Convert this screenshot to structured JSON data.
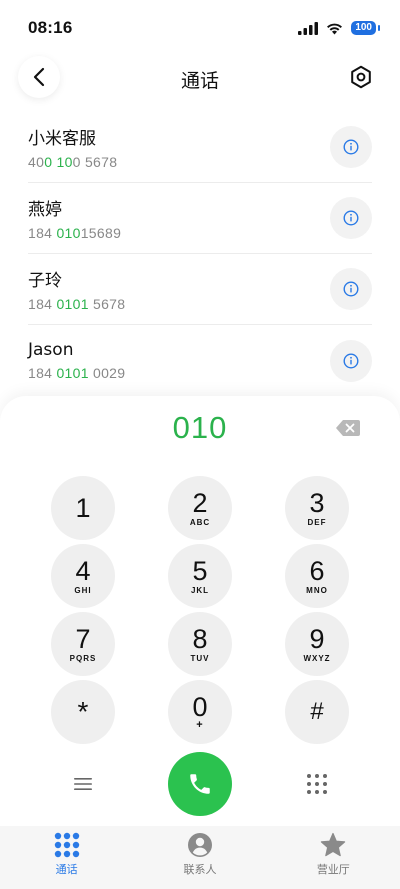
{
  "status_bar": {
    "time": "08:16",
    "battery": "100"
  },
  "header": {
    "title": "通话"
  },
  "contacts": [
    {
      "name": "小米客服",
      "number_parts": [
        "40",
        "0",
        " ",
        "10",
        "0 5678"
      ]
    },
    {
      "name": "燕婷",
      "number_parts": [
        "184 ",
        "010",
        "15689"
      ]
    },
    {
      "name": "子玲",
      "number_parts": [
        "184 ",
        "0101",
        " 5678"
      ]
    },
    {
      "name": "Jason",
      "number_parts": [
        "184 ",
        "0101",
        " 0029"
      ]
    }
  ],
  "dialer": {
    "input": "010",
    "keys": [
      {
        "digit": "1",
        "letters": ""
      },
      {
        "digit": "2",
        "letters": "ABC"
      },
      {
        "digit": "3",
        "letters": "DEF"
      },
      {
        "digit": "4",
        "letters": "GHI"
      },
      {
        "digit": "5",
        "letters": "JKL"
      },
      {
        "digit": "6",
        "letters": "MNO"
      },
      {
        "digit": "7",
        "letters": "PQRS"
      },
      {
        "digit": "8",
        "letters": "TUV"
      },
      {
        "digit": "9",
        "letters": "WXYZ"
      },
      {
        "digit": "*",
        "letters": ""
      },
      {
        "digit": "0",
        "letters": "+"
      },
      {
        "digit": "#",
        "letters": ""
      }
    ]
  },
  "tabs": [
    {
      "label": "通话",
      "icon": "dialpad-icon",
      "active": true
    },
    {
      "label": "联系人",
      "icon": "contacts-icon",
      "active": false
    },
    {
      "label": "营业厅",
      "icon": "star-icon",
      "active": false
    }
  ],
  "colors": {
    "accent_green": "#2bb24c",
    "call_green": "#2bc24f",
    "active_blue": "#2a7ae6",
    "info_blue": "#2a7ae6"
  }
}
